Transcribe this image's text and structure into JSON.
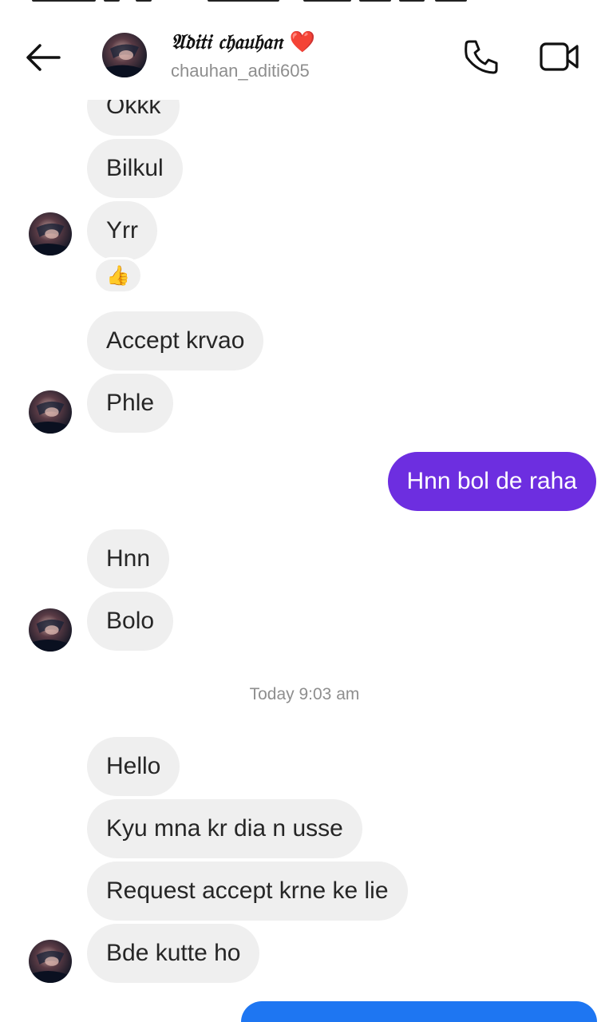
{
  "header": {
    "contact_name": "𝔄𝔡𝔦𝔱𝔦 𝔠𝔥𝔞𝔲𝔥𝔞𝔫",
    "heart": "❤️",
    "username": "chauhan_aditi605",
    "back_icon": "back-arrow-icon",
    "call_icon": "phone-icon",
    "video_icon": "video-camera-icon"
  },
  "messages": [
    {
      "text": "Okkk",
      "side": "in"
    },
    {
      "text": "Bilkul",
      "side": "in"
    },
    {
      "text": "Yrr",
      "side": "in",
      "reaction": "👍"
    },
    {
      "text": "Accept krvao",
      "side": "in"
    },
    {
      "text": "Phle",
      "side": "in"
    },
    {
      "text": "Hnn bol de raha",
      "side": "out"
    },
    {
      "text": "Hnn",
      "side": "in"
    },
    {
      "text": "Bolo",
      "side": "in"
    },
    {
      "text": "Hello",
      "side": "in"
    },
    {
      "text": "Kyu mna kr dia n usse",
      "side": "in"
    },
    {
      "text": "Request accept krne ke lie",
      "side": "in"
    },
    {
      "text": "Bde kutte ho",
      "side": "in"
    }
  ],
  "timestamp": "Today 9:03 am",
  "colors": {
    "incoming_bubble": "#efefef",
    "outgoing_bubble": "#6d2ee0",
    "outgoing_bubble_latest": "#1e76f2",
    "meta_text": "#8e8e8e"
  }
}
